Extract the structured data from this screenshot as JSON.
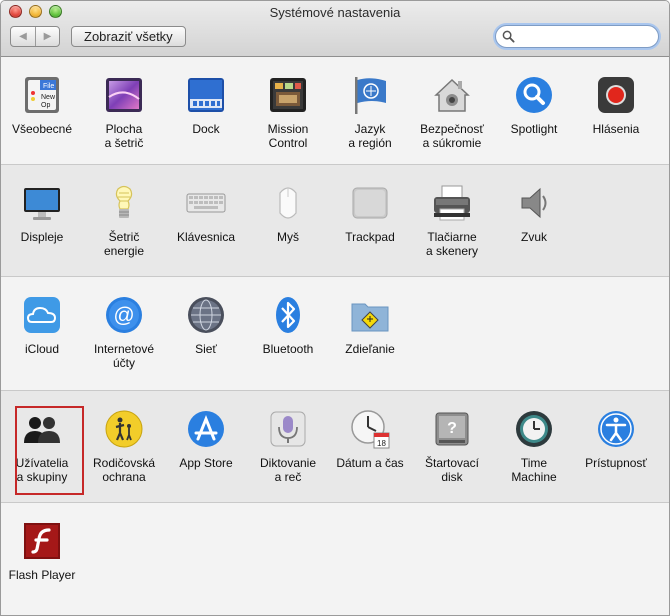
{
  "window": {
    "title": "Systémové nastavenia"
  },
  "toolbar": {
    "back_label": "◀",
    "forward_label": "▶",
    "show_all_label": "Zobraziť všetky",
    "search_value": "",
    "search_placeholder": ""
  },
  "sections": [
    {
      "panes": [
        {
          "id": "general",
          "label": "Všeobecné",
          "icon": "general-icon"
        },
        {
          "id": "desktop",
          "label": "Plocha\na šetrič",
          "icon": "desktop-icon"
        },
        {
          "id": "dock",
          "label": "Dock",
          "icon": "dock-icon"
        },
        {
          "id": "mission",
          "label": "Mission\nControl",
          "icon": "mission-control-icon"
        },
        {
          "id": "language",
          "label": "Jazyk\na región",
          "icon": "language-flag-icon"
        },
        {
          "id": "security",
          "label": "Bezpečnosť\na súkromie",
          "icon": "security-house-icon"
        },
        {
          "id": "spotlight",
          "label": "Spotlight",
          "icon": "spotlight-icon"
        },
        {
          "id": "notifications",
          "label": "Hlásenia",
          "icon": "notifications-icon"
        }
      ]
    },
    {
      "panes": [
        {
          "id": "displays",
          "label": "Displeje",
          "icon": "display-icon"
        },
        {
          "id": "energy",
          "label": "Šetrič\nenergie",
          "icon": "lightbulb-icon"
        },
        {
          "id": "keyboard",
          "label": "Klávesnica",
          "icon": "keyboard-icon"
        },
        {
          "id": "mouse",
          "label": "Myš",
          "icon": "mouse-icon"
        },
        {
          "id": "trackpad",
          "label": "Trackpad",
          "icon": "trackpad-icon"
        },
        {
          "id": "printers",
          "label": "Tlačiarne\na skenery",
          "icon": "printer-icon"
        },
        {
          "id": "sound",
          "label": "Zvuk",
          "icon": "speaker-icon"
        }
      ]
    },
    {
      "panes": [
        {
          "id": "icloud",
          "label": "iCloud",
          "icon": "icloud-icon"
        },
        {
          "id": "internet",
          "label": "Internetové\núčty",
          "icon": "internet-accounts-icon"
        },
        {
          "id": "network",
          "label": "Sieť",
          "icon": "network-globe-icon"
        },
        {
          "id": "bluetooth",
          "label": "Bluetooth",
          "icon": "bluetooth-icon"
        },
        {
          "id": "sharing",
          "label": "Zdieľanie",
          "icon": "sharing-folder-icon"
        }
      ]
    },
    {
      "panes": [
        {
          "id": "users",
          "label": "Užívatelia\na skupiny",
          "icon": "users-groups-icon",
          "selected": true
        },
        {
          "id": "parental",
          "label": "Rodičovská\nochrana",
          "icon": "parental-controls-icon"
        },
        {
          "id": "appstore",
          "label": "App Store",
          "icon": "app-store-icon"
        },
        {
          "id": "dictation",
          "label": "Diktovanie\na reč",
          "icon": "microphone-icon"
        },
        {
          "id": "datetime",
          "label": "Dátum a čas",
          "icon": "clock-calendar-icon",
          "calendar_day": "18"
        },
        {
          "id": "startup",
          "label": "Štartovací\ndisk",
          "icon": "startup-disk-icon"
        },
        {
          "id": "timemachine",
          "label": "Time\nMachine",
          "icon": "time-machine-icon"
        },
        {
          "id": "accessibility",
          "label": "Prístupnosť",
          "icon": "accessibility-icon"
        }
      ]
    },
    {
      "panes": [
        {
          "id": "flash",
          "label": "Flash Player",
          "icon": "flash-player-icon"
        }
      ]
    }
  ],
  "colors": {
    "highlight": "#c62828",
    "accent_blue": "#2a7fe0"
  }
}
